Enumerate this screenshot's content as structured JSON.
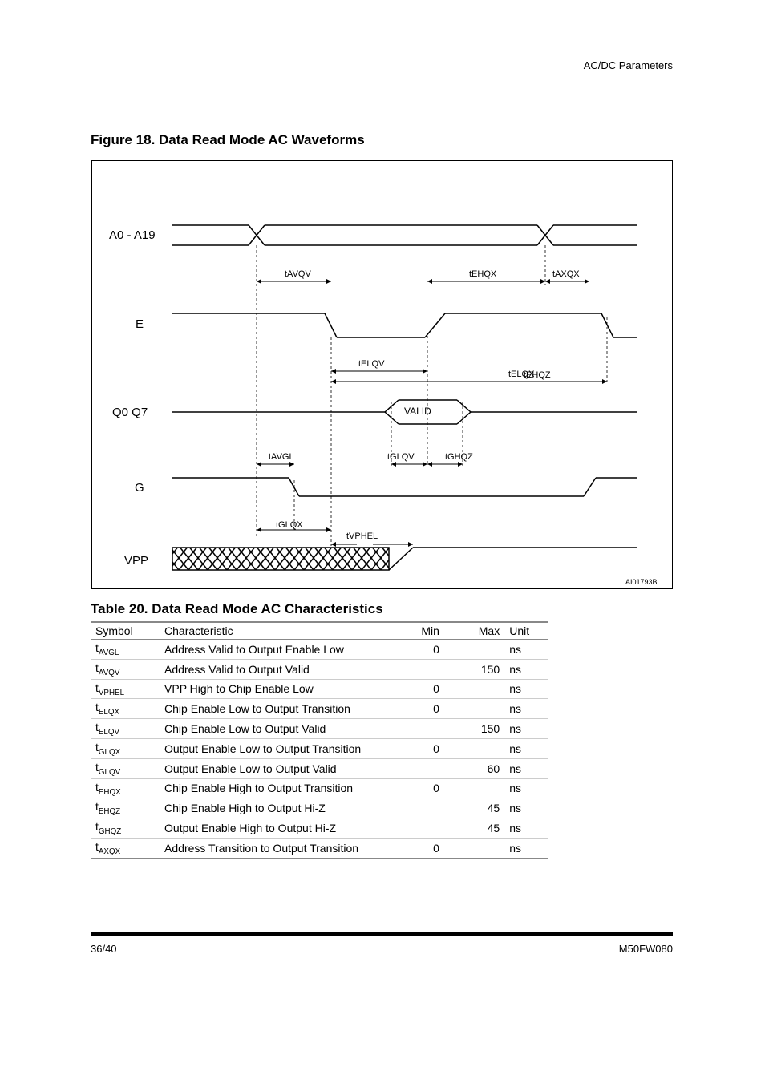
{
  "header": {
    "right": "AC/DC Parameters"
  },
  "figure": {
    "title": "Figure 18. Data Read Mode AC Waveforms"
  },
  "signals": {
    "addr": {
      "label": "A0 - A19"
    },
    "e": {
      "label": "E"
    },
    "q": {
      "label": "Q0   Q7"
    },
    "g": {
      "label": "G"
    },
    "vpp": {
      "label": "VPP"
    },
    "valid": {
      "label": "VALID"
    }
  },
  "timings": {
    "tavqv": "tAVQV",
    "tehqx": "tEHQX",
    "taxqx": "tAXQX",
    "telqv": "tELQV",
    "telqx": "tELQX",
    "tglqx": "tGLQX",
    "tglqv": "tGLQV",
    "tehqz": "tEHQZ",
    "tavgl": "tAVGL",
    "tghqz": "tGHQZ",
    "tvphel": "tVPHEL"
  },
  "table": {
    "title": "Table 20. Data Read Mode AC Characteristics",
    "columns": [
      "Symbol",
      "Characteristic",
      "Min",
      "Max",
      "Unit"
    ],
    "rows": [
      {
        "sym_html": "t<span class='sub'>AVGL</span>",
        "char": "Address Valid to Output Enable Low",
        "min": "0",
        "max": "",
        "unit": "ns"
      },
      {
        "sym_html": "t<span class='sub'>AVQV</span>",
        "char": "Address Valid to Output Valid",
        "min": "",
        "max": "150",
        "unit": "ns"
      },
      {
        "sym_html": "t<span class='sub'>VPHEL</span>",
        "char": "VPP High to Chip Enable Low",
        "min": "0",
        "max": "",
        "unit": "ns"
      },
      {
        "sym_html": "t<span class='sub'>ELQX</span>",
        "char": "Chip Enable Low to Output Transition",
        "min": "0",
        "max": "",
        "unit": "ns"
      },
      {
        "sym_html": "t<span class='sub'>ELQV</span>",
        "char": "Chip Enable Low to Output Valid",
        "min": "",
        "max": "150",
        "unit": "ns"
      },
      {
        "sym_html": "t<span class='sub'>GLQX</span>",
        "char": "Output Enable Low to Output Transition",
        "min": "0",
        "max": "",
        "unit": "ns"
      },
      {
        "sym_html": "t<span class='sub'>GLQV</span>",
        "char": "Output Enable Low to Output Valid",
        "min": "",
        "max": "60",
        "unit": "ns"
      },
      {
        "sym_html": "t<span class='sub'>EHQX</span>",
        "char": "Chip Enable High to Output Transition",
        "min": "0",
        "max": "",
        "unit": "ns"
      },
      {
        "sym_html": "t<span class='sub'>EHQZ</span>",
        "char": "Chip Enable High to Output Hi-Z",
        "min": "",
        "max": "45",
        "unit": "ns"
      },
      {
        "sym_html": "t<span class='sub'>GHQZ</span>",
        "char": "Output Enable High to Output Hi-Z",
        "min": "",
        "max": "45",
        "unit": "ns"
      },
      {
        "sym_html": "t<span class='sub'>AXQX</span>",
        "char": "Address Transition to Output Transition",
        "min": "0",
        "max": "",
        "unit": "ns"
      }
    ]
  },
  "footer": {
    "left": "36/40",
    "right": "M50FW080"
  },
  "chart_data": {
    "type": "timing-diagram",
    "signals": [
      {
        "name": "A0-A19",
        "kind": "bus",
        "events": [
          {
            "t": 0,
            "state": "valid"
          },
          {
            "t": 200,
            "state": "transition"
          },
          {
            "t": 215,
            "state": "valid"
          },
          {
            "t": 560,
            "state": "transition"
          },
          {
            "t": 575,
            "state": "valid"
          }
        ]
      },
      {
        "name": "E",
        "kind": "single",
        "events": [
          {
            "t": 0,
            "level": "high"
          },
          {
            "t": 295,
            "level": "fall"
          },
          {
            "t": 310,
            "level": "low"
          },
          {
            "t": 420,
            "level": "rise"
          },
          {
            "t": 445,
            "level": "high"
          },
          {
            "t": 640,
            "level": "fall"
          },
          {
            "t": 655,
            "level": "low"
          }
        ]
      },
      {
        "name": "Q0-Q7",
        "kind": "bus",
        "events": [
          {
            "t": 0,
            "state": "hi-z"
          },
          {
            "t": 373,
            "state": "transition"
          },
          {
            "t": 388,
            "state": "valid",
            "label": "VALID"
          },
          {
            "t": 460,
            "state": "transition"
          },
          {
            "t": 480,
            "state": "hi-z"
          }
        ]
      },
      {
        "name": "G",
        "kind": "single",
        "events": [
          {
            "t": 0,
            "level": "high"
          },
          {
            "t": 250,
            "level": "fall"
          },
          {
            "t": 260,
            "level": "low"
          },
          {
            "t": 618,
            "level": "rise"
          },
          {
            "t": 633,
            "level": "high"
          }
        ]
      },
      {
        "name": "VPP",
        "kind": "single",
        "events": [
          {
            "t": 0,
            "state": "invalid"
          },
          {
            "t": 380,
            "level": "rise"
          },
          {
            "t": 410,
            "level": "high"
          }
        ]
      }
    ],
    "annotations": [
      {
        "label": "tAVQV",
        "from_signal": "A0-A19",
        "from_event": "transition@200",
        "to_signal": "Q0-Q7",
        "to_event": "valid@388"
      },
      {
        "label": "tEHQX",
        "from_signal": "E",
        "from_event": "rise@420",
        "to_signal": "Q0-Q7",
        "to_event": "transition@460"
      },
      {
        "label": "tAXQX",
        "from_signal": "A0-A19",
        "from_event": "transition@560",
        "to_signal": "Q0-Q7",
        "to_event": "transition"
      },
      {
        "label": "tELQV",
        "from_signal": "E",
        "from_event": "fall@295",
        "to_signal": "Q0-Q7",
        "to_event": "valid@388"
      },
      {
        "label": "tELQX",
        "from_signal": "E",
        "from_event": "fall@295",
        "to_signal": "Q0-Q7",
        "to_event": "transition@373"
      },
      {
        "label": "tGLQX",
        "from_signal": "G",
        "from_event": "fall@250",
        "to_signal": "Q0-Q7",
        "to_event": "transition@373"
      },
      {
        "label": "tGLQV",
        "from_signal": "G",
        "from_event": "fall@250",
        "to_signal": "Q0-Q7",
        "to_event": "valid@388"
      },
      {
        "label": "tEHQZ",
        "from_signal": "E",
        "from_event": "rise@420",
        "to_signal": "Q0-Q7",
        "to_event": "hi-z@480"
      },
      {
        "label": "tAVGL",
        "from_signal": "A0-A19",
        "from_event": "transition@200",
        "to_signal": "G",
        "to_event": "fall@250"
      },
      {
        "label": "tGHQZ",
        "from_signal": "G",
        "from_event": "rise@618",
        "to_signal": "Q0-Q7",
        "to_event": "hi-z"
      },
      {
        "label": "tVPHEL",
        "from_signal": "VPP",
        "from_event": "rise@380",
        "to_signal": "E",
        "to_event": "fall"
      }
    ]
  }
}
